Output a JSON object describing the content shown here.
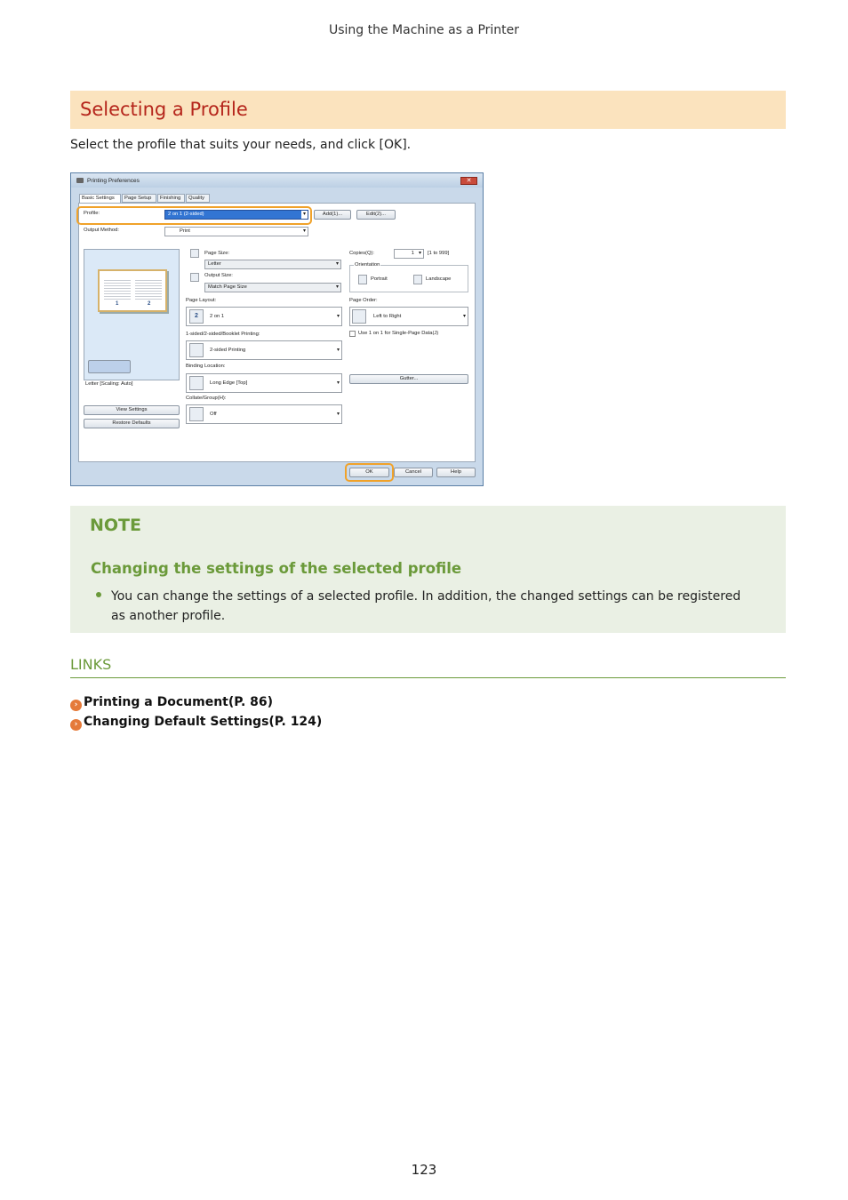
{
  "running_header": "Using the Machine as a Printer",
  "section_title": "Selecting a Profile",
  "intro_text": "Select the profile that suits your needs, and click [OK].",
  "dialog": {
    "title": "Printing Preferences",
    "close_glyph": "✕",
    "tabs": [
      "Basic Settings",
      "Page Setup",
      "Finishing",
      "Quality"
    ],
    "profile_label": "Profile:",
    "profile_value": "2 on 1 (2-sided)",
    "add_button": "Add(1)...",
    "edit_button": "Edit(2)...",
    "output_method_label": "Output Method:",
    "output_method_value": "Print",
    "page_size_label": "Page Size:",
    "page_size_value": "Letter",
    "output_size_label": "Output Size:",
    "output_size_value": "Match Page Size",
    "copies_label": "Copies(Q):",
    "copies_value": "1",
    "copies_range": "[1 to 999]",
    "orientation_label": "Orientation",
    "portrait_label": "Portrait",
    "landscape_label": "Landscape",
    "page_layout_label": "Page Layout:",
    "page_layout_value": "2 on 1",
    "page_layout_icon_number": "2",
    "page_order_label": "Page Order:",
    "page_order_value": "Left to Right",
    "print_mode_label": "1-sided/2-sided/Booklet Printing:",
    "print_mode_value": "2-sided Printing",
    "use_1on1_label": "Use 1 on 1 for Single-Page Data(J)",
    "binding_label": "Binding Location:",
    "binding_value": "Long Edge [Top]",
    "gutter_button": "Gutter...",
    "collate_label": "Collate/Group(H):",
    "collate_value": "Off",
    "preview_caption": "Letter [Scaling: Auto]",
    "preview_pages": [
      "1",
      "2"
    ],
    "view_settings_button": "View Settings",
    "restore_defaults_button": "Restore Defaults",
    "ok_button": "OK",
    "cancel_button": "Cancel",
    "help_button": "Help"
  },
  "note": {
    "heading": "NOTE",
    "subheading": "Changing the settings of the selected profile",
    "bullet": "You can change the settings of a selected profile. In addition, the changed settings can be registered as another profile."
  },
  "links": {
    "heading": "LINKS",
    "items": [
      "Printing a Document(P. 86)",
      "Changing Default Settings(P. 124)"
    ]
  },
  "page_number": "123",
  "colors": {
    "title_band": "#fbe3be",
    "title_text": "#b5251b",
    "note_bg": "#eaf0e4",
    "green_accent": "#6b9a3a",
    "link_icon": "#e57a3a",
    "highlight": "#f0a22a"
  }
}
